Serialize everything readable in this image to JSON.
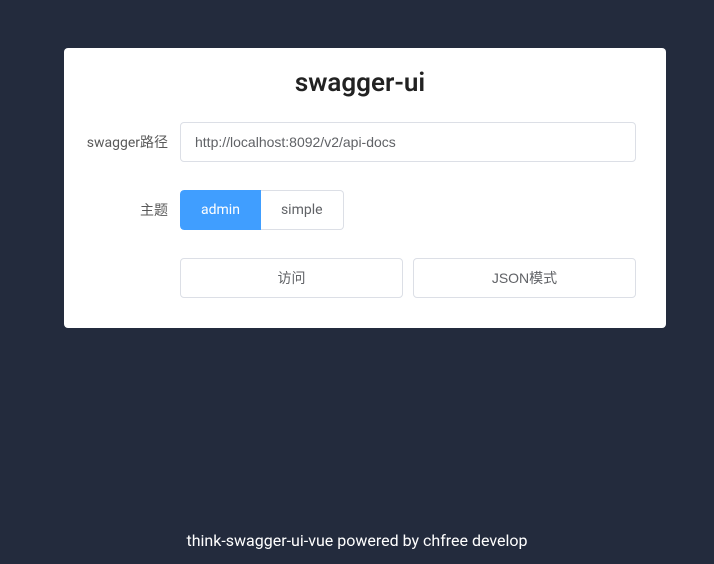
{
  "card": {
    "title": "swagger-ui"
  },
  "form": {
    "path_label": "swagger路径",
    "path_value": "http://localhost:8092/v2/api-docs",
    "theme_label": "主题",
    "theme_options": {
      "admin": "admin",
      "simple": "simple"
    }
  },
  "actions": {
    "visit": "访问",
    "json_mode": "JSON模式"
  },
  "footer": {
    "text": "think-swagger-ui-vue powered by chfree develop"
  }
}
